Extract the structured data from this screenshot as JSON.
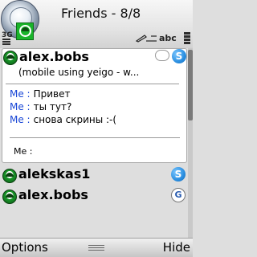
{
  "status_bar": {
    "network": "3G",
    "input_mode": "abc"
  },
  "header": {
    "title": "Friends - 8/8"
  },
  "chat": {
    "contact_name": "alex.bobs",
    "subtitle": "(mobile using yeigo - w...",
    "messages": [
      {
        "sender": "Me :",
        "text": "Привет"
      },
      {
        "sender": "Me :",
        "text": "ты тут?"
      },
      {
        "sender": "Me :",
        "text": "снова скрины :-("
      }
    ],
    "input_label": "Me :"
  },
  "contacts": [
    {
      "name": "alekskas1",
      "service_icon": "skype-icon"
    },
    {
      "name": "alex.bobs",
      "service_icon": "gtalk-icon"
    }
  ],
  "softkeys": {
    "left": "Options",
    "right": "Hide"
  },
  "colors": {
    "status_online": "#19b42a",
    "sender_label": "#1745d6"
  }
}
